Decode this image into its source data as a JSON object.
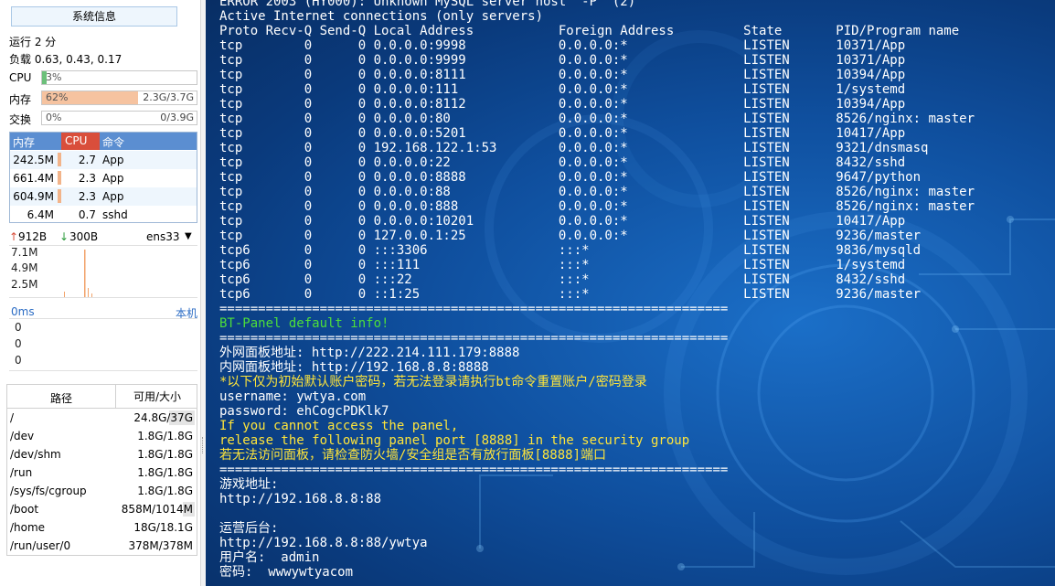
{
  "sidebar": {
    "sysinfo_button": "系统信息",
    "uptime": "运行 2 分",
    "load": "负载 0.63, 0.43, 0.17",
    "cpu": {
      "label": "CPU",
      "percent": "3%",
      "fraction": 0.03,
      "color": "#6cc07a"
    },
    "mem": {
      "label": "内存",
      "percent": "62%",
      "value": "2.3G/3.7G",
      "fraction": 0.62,
      "color": "#f6c3a0"
    },
    "swap": {
      "label": "交换",
      "percent": "0%",
      "value": "0/3.9G",
      "fraction": 0.0,
      "color": "#e6e6e6"
    },
    "proc_headers": {
      "mem": "内存",
      "cpu": "CPU",
      "cmd": "命令"
    },
    "processes": [
      {
        "mem": "242.5M",
        "cpu": "2.7",
        "cmd": "App"
      },
      {
        "mem": "661.4M",
        "cpu": "2.3",
        "cmd": "App"
      },
      {
        "mem": "604.9M",
        "cpu": "2.3",
        "cmd": "App"
      },
      {
        "mem": "6.4M",
        "cpu": "0.7",
        "cmd": "sshd"
      }
    ],
    "net": {
      "up": "912B",
      "down": "300B",
      "iface": "ens33",
      "ticks": [
        "7.1M",
        "4.9M",
        "2.5M"
      ]
    },
    "ping": {
      "label": "0ms",
      "host": "本机",
      "ticks": [
        "0",
        "0",
        "0"
      ]
    },
    "disk_headers": {
      "path": "路径",
      "size": "可用/大小"
    },
    "disks": [
      {
        "path": "/",
        "size": "24.8G/37G",
        "fraction": 0.33
      },
      {
        "path": "/dev",
        "size": "1.8G/1.8G",
        "fraction": 0.0
      },
      {
        "path": "/dev/shm",
        "size": "1.8G/1.8G",
        "fraction": 0.0
      },
      {
        "path": "/run",
        "size": "1.8G/1.8G",
        "fraction": 0.0
      },
      {
        "path": "/sys/fs/cgroup",
        "size": "1.8G/1.8G",
        "fraction": 0.0
      },
      {
        "path": "/boot",
        "size": "858M/1014M",
        "fraction": 0.15
      },
      {
        "path": "/home",
        "size": "18G/18.1G",
        "fraction": 0.0
      },
      {
        "path": "/run/user/0",
        "size": "378M/378M",
        "fraction": 0.0
      }
    ]
  },
  "terminal": {
    "lines": [
      {
        "t": "ERROR 2003 (HY000): Unknown MySQL server host '-P' (2)",
        "c": "white"
      },
      {
        "t": "Active Internet connections (only servers)",
        "c": "white"
      },
      {
        "t": "Proto Recv-Q Send-Q Local Address           Foreign Address         State       PID/Program name",
        "c": "white"
      },
      {
        "t": "tcp        0      0 0.0.0.0:9998            0.0.0.0:*               LISTEN      10371/App",
        "c": "white"
      },
      {
        "t": "tcp        0      0 0.0.0.0:9999            0.0.0.0:*               LISTEN      10371/App",
        "c": "white"
      },
      {
        "t": "tcp        0      0 0.0.0.0:8111            0.0.0.0:*               LISTEN      10394/App",
        "c": "white"
      },
      {
        "t": "tcp        0      0 0.0.0.0:111             0.0.0.0:*               LISTEN      1/systemd",
        "c": "white"
      },
      {
        "t": "tcp        0      0 0.0.0.0:8112            0.0.0.0:*               LISTEN      10394/App",
        "c": "white"
      },
      {
        "t": "tcp        0      0 0.0.0.0:80              0.0.0.0:*               LISTEN      8526/nginx: master",
        "c": "white"
      },
      {
        "t": "tcp        0      0 0.0.0.0:5201            0.0.0.0:*               LISTEN      10417/App",
        "c": "white"
      },
      {
        "t": "tcp        0      0 192.168.122.1:53        0.0.0.0:*               LISTEN      9321/dnsmasq",
        "c": "white"
      },
      {
        "t": "tcp        0      0 0.0.0.0:22              0.0.0.0:*               LISTEN      8432/sshd",
        "c": "white"
      },
      {
        "t": "tcp        0      0 0.0.0.0:8888            0.0.0.0:*               LISTEN      9647/python",
        "c": "white"
      },
      {
        "t": "tcp        0      0 0.0.0.0:88              0.0.0.0:*               LISTEN      8526/nginx: master",
        "c": "white"
      },
      {
        "t": "tcp        0      0 0.0.0.0:888             0.0.0.0:*               LISTEN      8526/nginx: master",
        "c": "white"
      },
      {
        "t": "tcp        0      0 0.0.0.0:10201           0.0.0.0:*               LISTEN      10417/App",
        "c": "white"
      },
      {
        "t": "tcp        0      0 127.0.0.1:25            0.0.0.0:*               LISTEN      9236/master",
        "c": "white"
      },
      {
        "t": "tcp6       0      0 :::3306                 :::*                    LISTEN      9836/mysqld",
        "c": "white"
      },
      {
        "t": "tcp6       0      0 :::111                  :::*                    LISTEN      1/systemd",
        "c": "white"
      },
      {
        "t": "tcp6       0      0 :::22                   :::*                    LISTEN      8432/sshd",
        "c": "white"
      },
      {
        "t": "tcp6       0      0 ::1:25                  :::*                    LISTEN      9236/master",
        "c": "white"
      },
      {
        "t": "==================================================================",
        "c": "white"
      },
      {
        "t": "BT-Panel default info!",
        "c": "green"
      },
      {
        "t": "==================================================================",
        "c": "white"
      },
      {
        "t": "外网面板地址: http://222.214.111.179:8888",
        "c": "white"
      },
      {
        "t": "内网面板地址: http://192.168.8.8:8888",
        "c": "white"
      },
      {
        "t": "*以下仅为初始默认账户密码，若无法登录请执行bt命令重置账户/密码登录",
        "c": "yellow"
      },
      {
        "t": "username: ywtya.com",
        "c": "white"
      },
      {
        "t": "password: ehCogcPDKlk7",
        "c": "white"
      },
      {
        "t": "If you cannot access the panel,",
        "c": "yellow"
      },
      {
        "t": "release the following panel port [8888] in the security group",
        "c": "yellow"
      },
      {
        "t": "若无法访问面板，请检查防火墙/安全组是否有放行面板[8888]端口",
        "c": "yellow"
      },
      {
        "t": "==================================================================",
        "c": "white"
      },
      {
        "t": "游戏地址:",
        "c": "white"
      },
      {
        "t": "http://192.168.8.8:88",
        "c": "white"
      },
      {
        "t": "",
        "c": "white"
      },
      {
        "t": "运营后台:",
        "c": "white"
      },
      {
        "t": "http://192.168.8.8:88/ywtya",
        "c": "white"
      },
      {
        "t": "用户名:  admin",
        "c": "white"
      },
      {
        "t": "密码:  wwwywtyacom",
        "c": "white"
      }
    ]
  }
}
